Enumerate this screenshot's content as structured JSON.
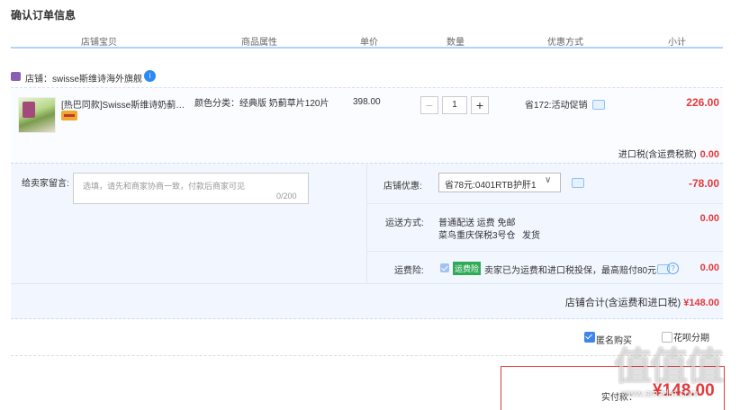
{
  "page_title": "确认订单信息",
  "columns": [
    "店铺宝贝",
    "商品属性",
    "单价",
    "数量",
    "优惠方式",
    "小计"
  ],
  "store": {
    "label": "店铺：swisse斯维诗海外旗舰",
    "badge": "i"
  },
  "item": {
    "name": "[热巴同款]Swisse斯维诗奶蓟…",
    "attr": "颜色分类：经典版 奶蓟草片120片",
    "price": "398.00",
    "qty": "1",
    "qty_minus": "−",
    "qty_plus": "+",
    "promo": "省172:活动促销",
    "subtotal": "226.00"
  },
  "import_tax": {
    "label": "进口税(含运费税款)",
    "value": "0.00"
  },
  "message": {
    "label": "给卖家留言:",
    "placeholder": "选填，请先和商家协商一致，付款后商家可见",
    "count": "0/200"
  },
  "store_discount": {
    "label": "店铺优惠:",
    "selected": "省78元:0401RTB护肝1",
    "arrow": "∨",
    "value": "-78.00"
  },
  "shipping": {
    "label": "运送方式:",
    "method": "普通配送 运费 免邮",
    "warehouse": "菜鸟重庆保税3号仓",
    "ship_note": "发货",
    "value": "0.00"
  },
  "insurance": {
    "label": "运费险:",
    "tag": "运费险",
    "text": "卖家已为运费和进口税投保，最高赔付80元",
    "help": "?",
    "value": "0.00"
  },
  "store_total": {
    "label": "店铺合计(含运费和进口税)",
    "value": "¥148.00"
  },
  "anonymous": {
    "label": "匿名购买",
    "checked": true
  },
  "partial": {
    "label": "花呗分期"
  },
  "pay": {
    "label": "实付款：",
    "amount": "¥148.00"
  },
  "watermark": {
    "big": "值值值",
    "small": "www.smzdm.com"
  },
  "colors": {
    "accent_red": "#e4393c",
    "panel_blue": "#f2f7ff",
    "header_line": "#b2d1ff",
    "link_blue": "#2b8bf2"
  }
}
